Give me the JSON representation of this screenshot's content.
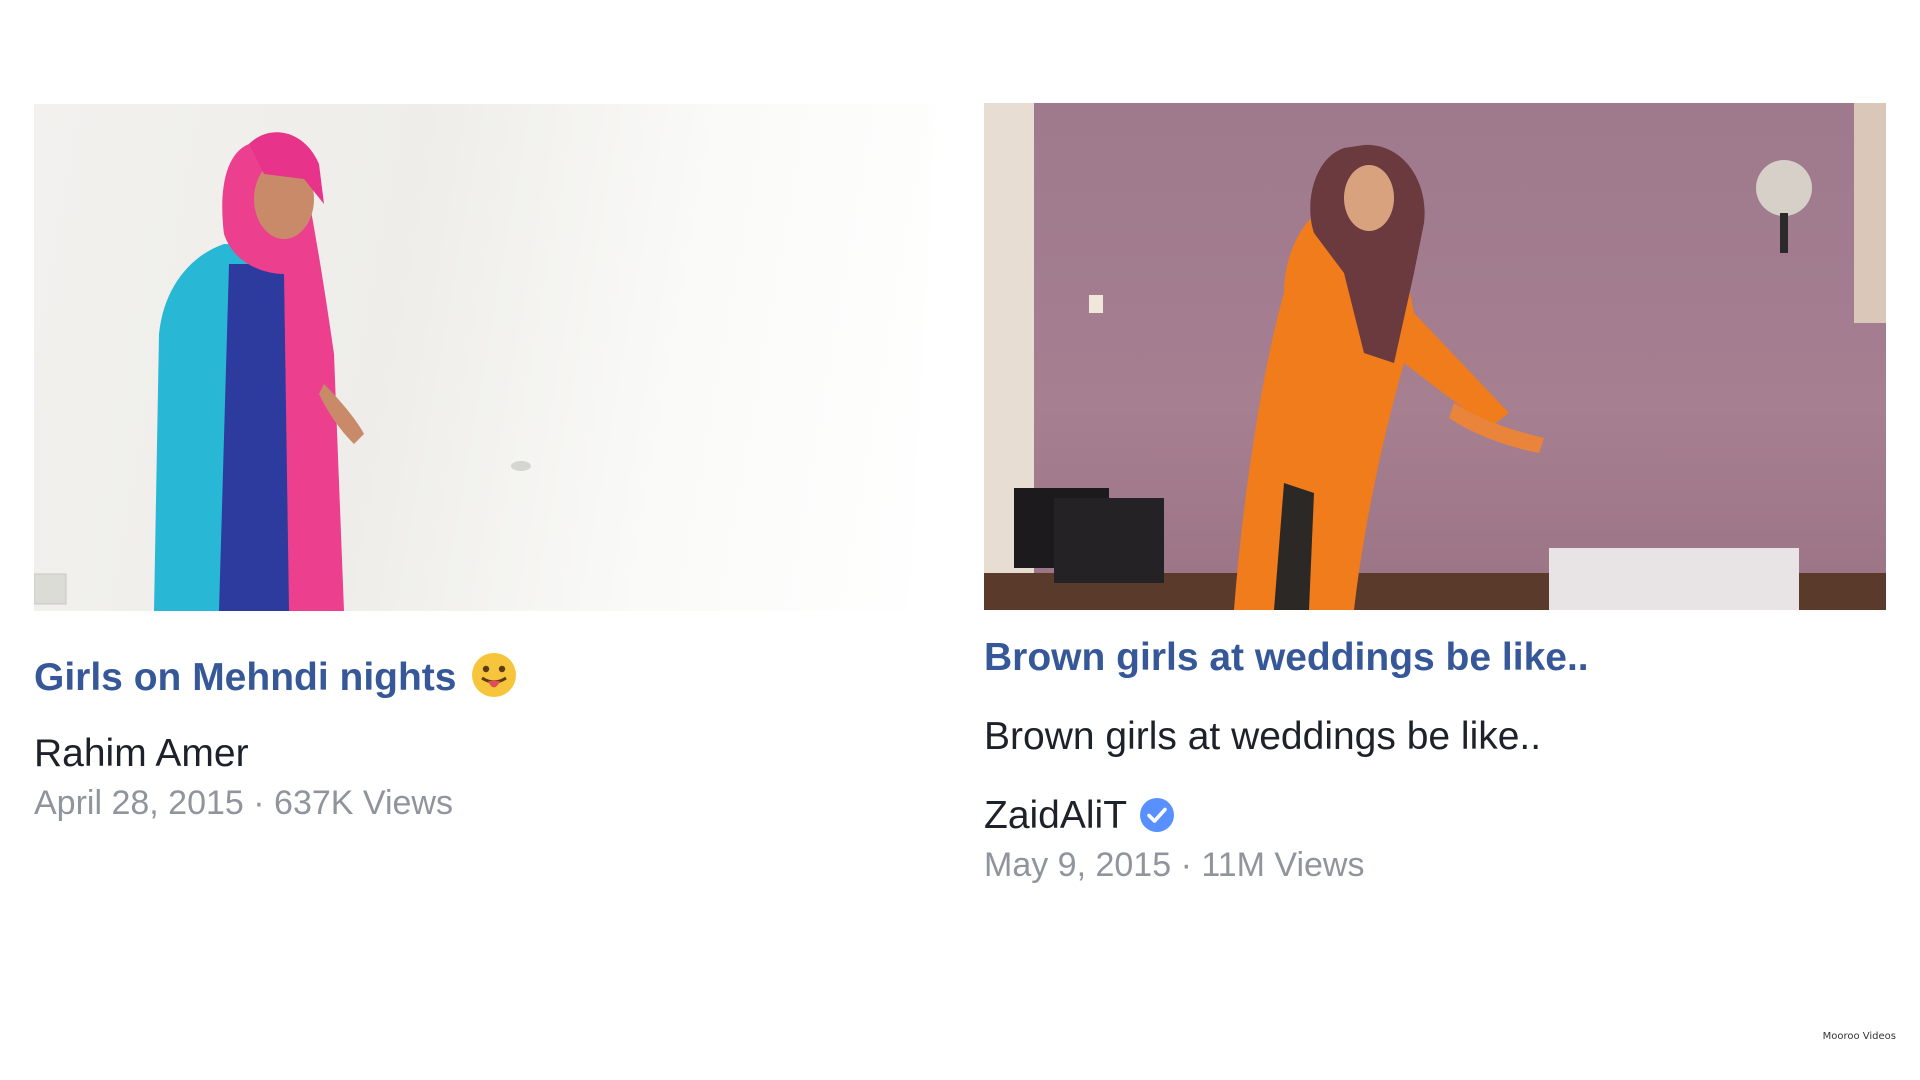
{
  "videos": [
    {
      "title": "Girls on Mehndi nights",
      "title_emoji_icon": "tongue-out-emoji-icon",
      "author": "Rahim Amer",
      "date": "April 28, 2015",
      "separator": " · ",
      "views": "637K Views"
    },
    {
      "title": "Brown girls at weddings be like..",
      "description": "Brown girls at weddings be like..",
      "author": "ZaidAliT",
      "author_badge_icon": "verified-badge-icon",
      "date": "May 9, 2015",
      "separator": " · ",
      "views": "11M Views"
    }
  ],
  "watermark": "Mooroo Videos",
  "colors": {
    "title_link": "#365899",
    "primary_text": "#1d2129",
    "meta_text": "#90949c",
    "verified_badge": "#5890ff"
  }
}
